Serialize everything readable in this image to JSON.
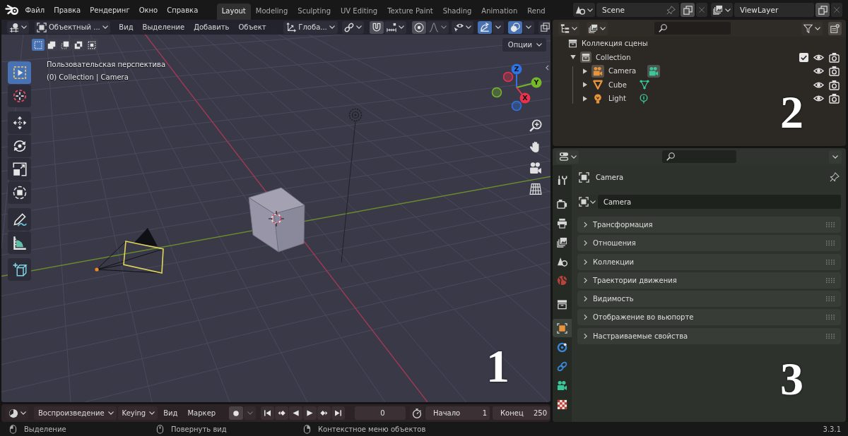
{
  "top_bar": {
    "menus": [
      "Файл",
      "Правка",
      "Рендеринг",
      "Окно",
      "Справка"
    ],
    "workspaces": [
      {
        "label": "Layout",
        "selected": true
      },
      {
        "label": "Modeling",
        "selected": false
      },
      {
        "label": "Sculpting",
        "selected": false
      },
      {
        "label": "UV Editing",
        "selected": false
      },
      {
        "label": "Texture Paint",
        "selected": false
      },
      {
        "label": "Shading",
        "selected": false
      },
      {
        "label": "Animation",
        "selected": false
      },
      {
        "label": "Rend",
        "selected": false
      }
    ],
    "scene": "Scene",
    "view_layer": "ViewLayer"
  },
  "viewport": {
    "header": {
      "mode": "Объектный ...",
      "menus": [
        "Вид",
        "Выделение",
        "Добавить",
        "Объект"
      ],
      "orientation": "Глоба...",
      "toggles": [
        {
          "kind": "snap",
          "on": false
        },
        {
          "kind": "proportional",
          "on": false
        },
        {
          "kind": "gizmos",
          "on": true
        },
        {
          "kind": "overlays",
          "on": true
        }
      ]
    },
    "select_modes": [
      {
        "kind": "set",
        "selected": true
      },
      {
        "kind": "extend",
        "selected": false
      },
      {
        "kind": "subtract",
        "selected": false
      },
      {
        "kind": "invert",
        "selected": false
      },
      {
        "kind": "intersect",
        "selected": false
      }
    ],
    "options": "Опции",
    "tool_groups": [
      [
        {
          "kind": "select",
          "selected": true
        },
        {
          "kind": "cursor",
          "selected": false
        }
      ],
      [
        {
          "kind": "move",
          "selected": false
        },
        {
          "kind": "rotate",
          "selected": false
        },
        {
          "kind": "scale",
          "selected": false
        },
        {
          "kind": "transform",
          "selected": false
        }
      ],
      [
        {
          "kind": "annotate",
          "selected": false
        },
        {
          "kind": "measure",
          "selected": false
        }
      ],
      [
        {
          "kind": "add_cube",
          "selected": false
        }
      ]
    ],
    "info": [
      "Пользовательская перспектива",
      "(0) Collection | Camera"
    ],
    "gizmo": {
      "axes": [
        {
          "label": "Z",
          "color": "#2e74e6"
        },
        {
          "label": "Y",
          "color": "#76b82a"
        },
        {
          "label": "X",
          "color": "#e8334f"
        }
      ]
    },
    "annotation": "1"
  },
  "outliner": {
    "root": "Коллекция сцены",
    "collections": [
      {
        "label": "Collection",
        "expanded": true,
        "active": true,
        "checked": true,
        "children": [
          {
            "label": "Camera",
            "kind": "camera",
            "expanded": false,
            "active": true
          },
          {
            "label": "Cube",
            "kind": "mesh",
            "expanded": false,
            "active": false
          },
          {
            "label": "Light",
            "kind": "light",
            "expanded": false,
            "active": false
          }
        ]
      }
    ],
    "annotation": "2"
  },
  "properties": {
    "tab_groups": [
      [
        {
          "kind": "tool",
          "selected": false
        }
      ],
      [
        {
          "kind": "render",
          "selected": false
        },
        {
          "kind": "output",
          "selected": false
        },
        {
          "kind": "view_layer",
          "selected": false
        },
        {
          "kind": "scene",
          "selected": false
        },
        {
          "kind": "world",
          "selected": false
        }
      ],
      [
        {
          "kind": "collection",
          "selected": false
        }
      ],
      [
        {
          "kind": "object",
          "selected": true
        },
        {
          "kind": "physics",
          "selected": false
        },
        {
          "kind": "constraints",
          "selected": false
        },
        {
          "kind": "data",
          "selected": false
        },
        {
          "kind": "texture",
          "selected": false
        }
      ]
    ],
    "title": "Camera",
    "name": "Camera",
    "panels": [
      {
        "label": "Трансформация",
        "expanded": false
      },
      {
        "label": "Отношения",
        "expanded": false
      },
      {
        "label": "Коллекции",
        "expanded": false
      },
      {
        "label": "Траектории движения",
        "expanded": false
      },
      {
        "label": "Видимость",
        "expanded": false
      },
      {
        "label": "Отображение во вьюпорте",
        "expanded": false
      },
      {
        "label": "Настраиваемые свойства",
        "expanded": false
      }
    ],
    "annotation": "3"
  },
  "timeline": {
    "menus": [
      {
        "label": "Воспроизведение",
        "kind": "dropdown"
      },
      {
        "label": "Keying",
        "kind": "dropdown"
      },
      {
        "label": "Вид",
        "kind": "menu"
      },
      {
        "label": "Маркер",
        "kind": "menu"
      }
    ],
    "frame": "0",
    "start": {
      "label": "Начало",
      "value": "1"
    },
    "end": {
      "label": "Конец",
      "value": "250"
    }
  },
  "status_bar": {
    "hints": [
      {
        "kind": "left",
        "text": "Выделение"
      },
      {
        "kind": "middle",
        "text": "Повернуть вид"
      },
      {
        "kind": "right",
        "text": "Контекстное меню объектов"
      }
    ],
    "version": "3.3.1"
  }
}
